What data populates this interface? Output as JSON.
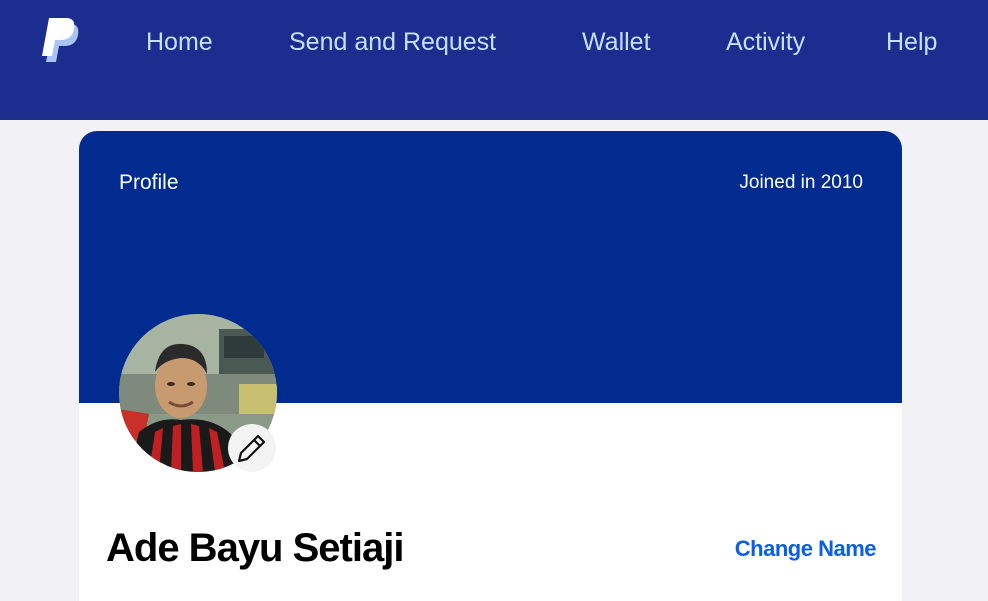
{
  "nav": {
    "logo_icon": "paypal-logo-icon",
    "items": [
      {
        "label": "Home"
      },
      {
        "label": "Send and Request"
      },
      {
        "label": "Wallet"
      },
      {
        "label": "Activity"
      },
      {
        "label": "Help"
      }
    ]
  },
  "profile": {
    "section_label": "Profile",
    "joined_text": "Joined in 2010",
    "avatar_icon": "profile-photo",
    "edit_icon": "pencil-icon",
    "name": "Ade Bayu Setiaji",
    "change_name_label": "Change Name"
  },
  "colors": {
    "nav_bg": "#1b2d8f",
    "nav_text": "#c7e0ff",
    "banner_bg": "#012b8f",
    "link": "#0a5ee8",
    "page_bg": "#f1f1f6"
  }
}
